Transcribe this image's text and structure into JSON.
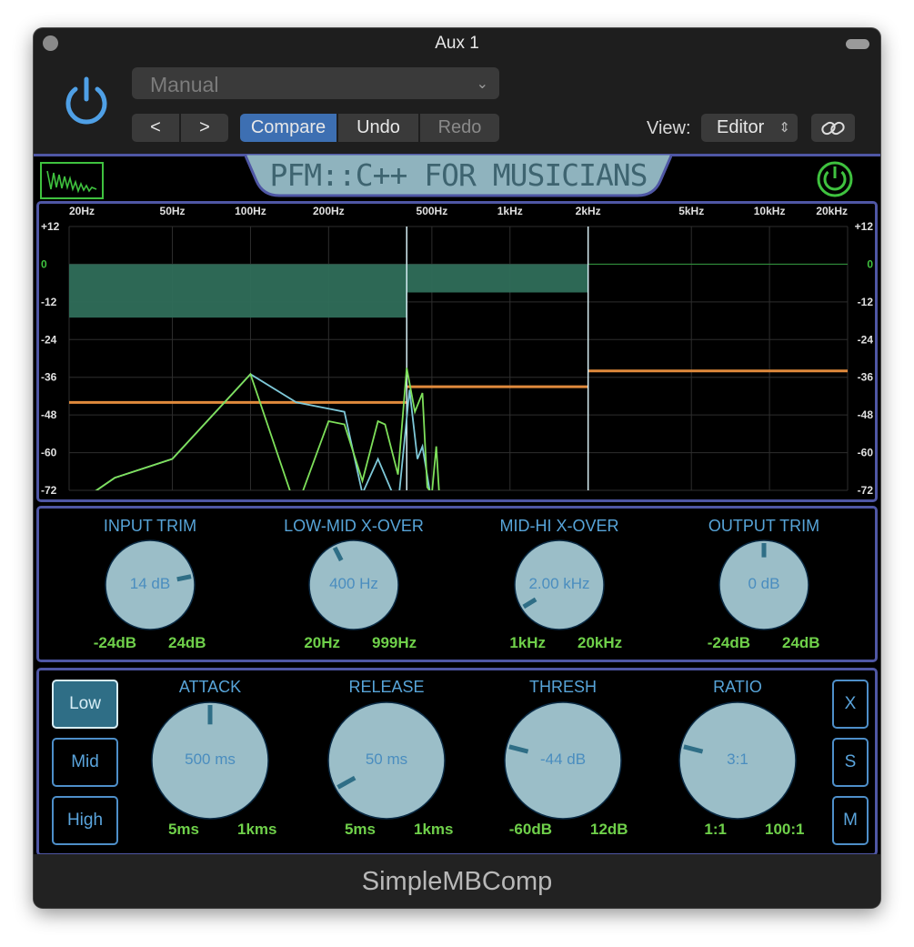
{
  "window": {
    "title": "Aux 1"
  },
  "host_toolbar": {
    "preset_value": "Manual",
    "prev_label": "<",
    "next_label": ">",
    "compare_label": "Compare",
    "undo_label": "Undo",
    "redo_label": "Redo",
    "view_label": "View:",
    "view_value": "Editor",
    "accent_color": "#3d6fb2"
  },
  "plugin": {
    "banner_title": "PFM::C++ FOR MUSICIANS",
    "product_name": "SimpleMBComp",
    "accent_color": "#4f57a5",
    "bypass_on": true,
    "band_on_color": "#2f6e7c"
  },
  "spectrum": {
    "freq_labels": [
      "20Hz",
      "50Hz",
      "100Hz",
      "200Hz",
      "500Hz",
      "1kHz",
      "2kHz",
      "5kHz",
      "10kHz",
      "20kHz"
    ],
    "freq_values": [
      20,
      50,
      100,
      200,
      500,
      1000,
      2000,
      5000,
      10000,
      20000
    ],
    "db_labels": [
      "+12",
      "0",
      "-12",
      "-24",
      "-36",
      "-48",
      "-60",
      "-72"
    ],
    "db_values": [
      12,
      0,
      -12,
      -24,
      -36,
      -48,
      -60,
      -72
    ],
    "crossovers_hz": [
      400,
      2000
    ],
    "band_thresholds_db": [
      -44,
      -39,
      -34
    ],
    "band_gain_reduction_db": [
      -17,
      -9,
      0
    ],
    "series": [
      {
        "color": "#7ec8d8",
        "points": [
          [
            20,
            -78
          ],
          [
            30,
            -68
          ],
          [
            50,
            -62
          ],
          [
            100,
            -35
          ],
          [
            150,
            -44
          ],
          [
            200,
            -46
          ],
          [
            230,
            -47
          ],
          [
            270,
            -73
          ],
          [
            310,
            -62
          ],
          [
            370,
            -77
          ],
          [
            410,
            -40
          ],
          [
            440,
            -62
          ],
          [
            460,
            -58
          ],
          [
            490,
            -72
          ],
          [
            500,
            -76
          ],
          [
            560,
            -76
          ],
          [
            580,
            -80
          ]
        ]
      },
      {
        "color": "#7ee05a",
        "points": [
          [
            20,
            -78
          ],
          [
            30,
            -68
          ],
          [
            50,
            -62
          ],
          [
            100,
            -35
          ],
          [
            150,
            -78
          ],
          [
            200,
            -50
          ],
          [
            230,
            -51
          ],
          [
            270,
            -69
          ],
          [
            310,
            -50
          ],
          [
            330,
            -51
          ],
          [
            370,
            -67
          ],
          [
            400,
            -33
          ],
          [
            430,
            -47
          ],
          [
            460,
            -41
          ],
          [
            480,
            -71
          ],
          [
            500,
            -73
          ],
          [
            520,
            -58
          ],
          [
            540,
            -80
          ],
          [
            580,
            -80
          ]
        ]
      }
    ]
  },
  "global_controls": [
    {
      "title": "INPUT TRIM",
      "value": "14 dB",
      "min": "-24dB",
      "max": "24dB",
      "position": 0.79
    },
    {
      "title": "LOW-MID X-OVER",
      "value": "400 Hz",
      "min": "20Hz",
      "max": "999Hz",
      "position": 0.4
    },
    {
      "title": "MID-HI X-OVER",
      "value": "2.00 kHz",
      "min": "1kHz",
      "max": "20kHz",
      "position": 0.05
    },
    {
      "title": "OUTPUT TRIM",
      "value": "0 dB",
      "min": "-24dB",
      "max": "24dB",
      "position": 0.5
    }
  ],
  "band_select": {
    "items": [
      "Low",
      "Mid",
      "High"
    ],
    "selected": "Low"
  },
  "band_controls": [
    {
      "title": "ATTACK",
      "value": "500 ms",
      "min": "5ms",
      "max": "1kms",
      "position": 0.5
    },
    {
      "title": "RELEASE",
      "value": "50 ms",
      "min": "5ms",
      "max": "1kms",
      "position": 0.06
    },
    {
      "title": "THRESH",
      "value": "-44 dB",
      "min": "-60dB",
      "max": "12dB",
      "position": 0.22
    },
    {
      "title": "RATIO",
      "value": "3:1",
      "min": "1:1",
      "max": "100:1",
      "position": 0.22
    }
  ],
  "band_buttons": {
    "x": "X",
    "s": "S",
    "m": "M"
  }
}
